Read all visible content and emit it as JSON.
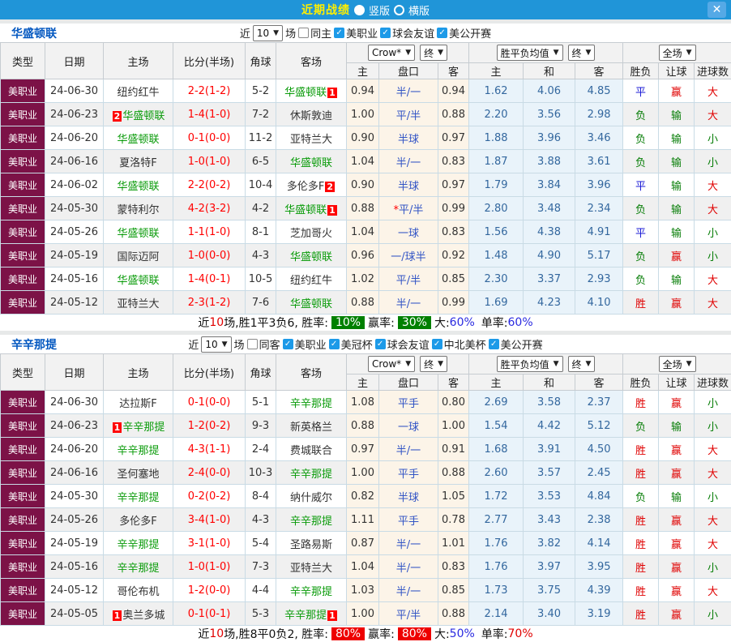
{
  "colors": {
    "accent_blue": "#2095d8",
    "title_yellow": "#ffef00",
    "type_cell_maroon": "#7c1247",
    "team_green": "#099b09",
    "score_red": "#ff0000",
    "win_red": "#e00000",
    "lose_green": "#067d06",
    "draw_blue": "#1b1bd6"
  },
  "topbar": {
    "title": "近期战绩",
    "vertical_label": "竖版",
    "horizontal_label": "横版",
    "close_label": "✕"
  },
  "controls": {
    "near_label": "近",
    "games_label": "场",
    "bookmaker": "Crow*",
    "final_label_asia": "终",
    "odds_average": "胜平负均值",
    "final_label_europe": "终",
    "scope": "全场"
  },
  "table": {
    "col_type": "类型",
    "col_date": "日期",
    "col_home": "主场",
    "col_score": "比分(半场)",
    "col_corner": "角球",
    "col_away": "客场",
    "col_ah_home": "主",
    "col_handicap": "盘口",
    "col_ah_away": "客",
    "col_eu_home": "主",
    "col_eu_draw": "和",
    "col_eu_away": "客",
    "col_result": "胜负",
    "col_handicap_result": "让球",
    "col_goals": "进球数"
  },
  "sections": [
    {
      "team": "华盛顿联",
      "games_count": "10",
      "same_label": "同主",
      "same_checked": false,
      "leagues": [
        {
          "label": "美职业",
          "checked": true
        },
        {
          "label": "球会友谊",
          "checked": true
        },
        {
          "label": "美公开赛",
          "checked": true
        }
      ],
      "rows": [
        {
          "type": "美职业",
          "date": "24-06-30",
          "home": "纽约红牛",
          "home_green": false,
          "home_badge": "",
          "home_badge_pos": "",
          "score": "2-2(1-2)",
          "corner": "5-2",
          "away": "华盛顿联",
          "away_green": true,
          "away_badge": "1",
          "away_badge_pos": "after",
          "ah_home": "0.94",
          "handicap": "半/一",
          "handicap_star": false,
          "ah_away": "0.94",
          "eu_home": "1.62",
          "eu_draw": "4.06",
          "eu_away": "4.85",
          "result": "平",
          "handicap_result": "赢",
          "goals": "大"
        },
        {
          "type": "美职业",
          "date": "24-06-23",
          "home": "华盛顿联",
          "home_green": true,
          "home_badge": "2",
          "home_badge_pos": "before",
          "score": "1-4(1-0)",
          "corner": "7-2",
          "away": "休斯敦迪",
          "away_green": false,
          "away_badge": "",
          "away_badge_pos": "",
          "ah_home": "1.00",
          "handicap": "平/半",
          "handicap_star": false,
          "ah_away": "0.88",
          "eu_home": "2.20",
          "eu_draw": "3.56",
          "eu_away": "2.98",
          "result": "负",
          "handicap_result": "输",
          "goals": "大"
        },
        {
          "type": "美职业",
          "date": "24-06-20",
          "home": "华盛顿联",
          "home_green": true,
          "home_badge": "",
          "home_badge_pos": "",
          "score": "0-1(0-0)",
          "corner": "11-2",
          "away": "亚特兰大",
          "away_green": false,
          "away_badge": "",
          "away_badge_pos": "",
          "ah_home": "0.90",
          "handicap": "半球",
          "handicap_star": false,
          "ah_away": "0.97",
          "eu_home": "1.88",
          "eu_draw": "3.96",
          "eu_away": "3.46",
          "result": "负",
          "handicap_result": "输",
          "goals": "小"
        },
        {
          "type": "美职业",
          "date": "24-06-16",
          "home": "夏洛特F",
          "home_green": false,
          "home_badge": "",
          "home_badge_pos": "",
          "score": "1-0(1-0)",
          "corner": "6-5",
          "away": "华盛顿联",
          "away_green": true,
          "away_badge": "",
          "away_badge_pos": "",
          "ah_home": "1.04",
          "handicap": "半/一",
          "handicap_star": false,
          "ah_away": "0.83",
          "eu_home": "1.87",
          "eu_draw": "3.88",
          "eu_away": "3.61",
          "result": "负",
          "handicap_result": "输",
          "goals": "小"
        },
        {
          "type": "美职业",
          "date": "24-06-02",
          "home": "华盛顿联",
          "home_green": true,
          "home_badge": "",
          "home_badge_pos": "",
          "score": "2-2(0-2)",
          "corner": "10-4",
          "away": "多伦多F",
          "away_green": false,
          "away_badge": "2",
          "away_badge_pos": "after",
          "ah_home": "0.90",
          "handicap": "半球",
          "handicap_star": false,
          "ah_away": "0.97",
          "eu_home": "1.79",
          "eu_draw": "3.84",
          "eu_away": "3.96",
          "result": "平",
          "handicap_result": "输",
          "goals": "大"
        },
        {
          "type": "美职业",
          "date": "24-05-30",
          "home": "蒙特利尔",
          "home_green": false,
          "home_badge": "",
          "home_badge_pos": "",
          "score": "4-2(3-2)",
          "corner": "4-2",
          "away": "华盛顿联",
          "away_green": true,
          "away_badge": "1",
          "away_badge_pos": "after",
          "ah_home": "0.88",
          "handicap": "平/半",
          "handicap_star": true,
          "ah_away": "0.99",
          "eu_home": "2.80",
          "eu_draw": "3.48",
          "eu_away": "2.34",
          "result": "负",
          "handicap_result": "输",
          "goals": "大"
        },
        {
          "type": "美职业",
          "date": "24-05-26",
          "home": "华盛顿联",
          "home_green": true,
          "home_badge": "",
          "home_badge_pos": "",
          "score": "1-1(1-0)",
          "corner": "8-1",
          "away": "芝加哥火",
          "away_green": false,
          "away_badge": "",
          "away_badge_pos": "",
          "ah_home": "1.04",
          "handicap": "一球",
          "handicap_star": false,
          "ah_away": "0.83",
          "eu_home": "1.56",
          "eu_draw": "4.38",
          "eu_away": "4.91",
          "result": "平",
          "handicap_result": "输",
          "goals": "小"
        },
        {
          "type": "美职业",
          "date": "24-05-19",
          "home": "国际迈阿",
          "home_green": false,
          "home_badge": "",
          "home_badge_pos": "",
          "score": "1-0(0-0)",
          "corner": "4-3",
          "away": "华盛顿联",
          "away_green": true,
          "away_badge": "",
          "away_badge_pos": "",
          "ah_home": "0.96",
          "handicap": "一/球半",
          "handicap_star": false,
          "ah_away": "0.92",
          "eu_home": "1.48",
          "eu_draw": "4.90",
          "eu_away": "5.17",
          "result": "负",
          "handicap_result": "赢",
          "goals": "小"
        },
        {
          "type": "美职业",
          "date": "24-05-16",
          "home": "华盛顿联",
          "home_green": true,
          "home_badge": "",
          "home_badge_pos": "",
          "score": "1-4(0-1)",
          "corner": "10-5",
          "away": "纽约红牛",
          "away_green": false,
          "away_badge": "",
          "away_badge_pos": "",
          "ah_home": "1.02",
          "handicap": "平/半",
          "handicap_star": false,
          "ah_away": "0.85",
          "eu_home": "2.30",
          "eu_draw": "3.37",
          "eu_away": "2.93",
          "result": "负",
          "handicap_result": "输",
          "goals": "大"
        },
        {
          "type": "美职业",
          "date": "24-05-12",
          "home": "亚特兰大",
          "home_green": false,
          "home_badge": "",
          "home_badge_pos": "",
          "score": "2-3(1-2)",
          "corner": "7-6",
          "away": "华盛顿联",
          "away_green": true,
          "away_badge": "",
          "away_badge_pos": "",
          "ah_home": "0.88",
          "handicap": "半/一",
          "handicap_star": false,
          "ah_away": "0.99",
          "eu_home": "1.69",
          "eu_draw": "4.23",
          "eu_away": "4.10",
          "result": "胜",
          "handicap_result": "赢",
          "goals": "大"
        }
      ],
      "summary": {
        "lead_plain": "近",
        "lead_games": "10",
        "lead_rest": "场,胜1平3负6, 胜率:",
        "rate1": "10%",
        "rate1_bg": "#008000",
        "mid": "赢率:",
        "rate2": "30%",
        "rate2_bg": "#008000",
        "big_label": "大:",
        "big_value": "60%",
        "big_color": "#2a2ae0",
        "single_label": "单率:",
        "single_value": "60%",
        "single_color": "#2a2ae0"
      }
    },
    {
      "team": "辛辛那提",
      "games_count": "10",
      "same_label": "同客",
      "same_checked": false,
      "leagues": [
        {
          "label": "美职业",
          "checked": true
        },
        {
          "label": "美冠杯",
          "checked": true
        },
        {
          "label": "球会友谊",
          "checked": true
        },
        {
          "label": "中北美杯",
          "checked": true
        },
        {
          "label": "美公开赛",
          "checked": true
        }
      ],
      "rows": [
        {
          "type": "美职业",
          "date": "24-06-30",
          "home": "达拉斯F",
          "home_green": false,
          "home_badge": "",
          "home_badge_pos": "",
          "score": "0-1(0-0)",
          "corner": "5-1",
          "away": "辛辛那提",
          "away_green": true,
          "away_badge": "",
          "away_badge_pos": "",
          "ah_home": "1.08",
          "handicap": "平手",
          "handicap_star": false,
          "ah_away": "0.80",
          "eu_home": "2.69",
          "eu_draw": "3.58",
          "eu_away": "2.37",
          "result": "胜",
          "handicap_result": "赢",
          "goals": "小"
        },
        {
          "type": "美职业",
          "date": "24-06-23",
          "home": "辛辛那提",
          "home_green": true,
          "home_badge": "1",
          "home_badge_pos": "before",
          "score": "1-2(0-2)",
          "corner": "9-3",
          "away": "新英格兰",
          "away_green": false,
          "away_badge": "",
          "away_badge_pos": "",
          "ah_home": "0.88",
          "handicap": "一球",
          "handicap_star": false,
          "ah_away": "1.00",
          "eu_home": "1.54",
          "eu_draw": "4.42",
          "eu_away": "5.12",
          "result": "负",
          "handicap_result": "输",
          "goals": "小"
        },
        {
          "type": "美职业",
          "date": "24-06-20",
          "home": "辛辛那提",
          "home_green": true,
          "home_badge": "",
          "home_badge_pos": "",
          "score": "4-3(1-1)",
          "corner": "2-4",
          "away": "费城联合",
          "away_green": false,
          "away_badge": "",
          "away_badge_pos": "",
          "ah_home": "0.97",
          "handicap": "半/一",
          "handicap_star": false,
          "ah_away": "0.91",
          "eu_home": "1.68",
          "eu_draw": "3.91",
          "eu_away": "4.50",
          "result": "胜",
          "handicap_result": "赢",
          "goals": "大"
        },
        {
          "type": "美职业",
          "date": "24-06-16",
          "home": "圣何塞地",
          "home_green": false,
          "home_badge": "",
          "home_badge_pos": "",
          "score": "2-4(0-0)",
          "corner": "10-3",
          "away": "辛辛那提",
          "away_green": true,
          "away_badge": "",
          "away_badge_pos": "",
          "ah_home": "1.00",
          "handicap": "平手",
          "handicap_star": false,
          "ah_away": "0.88",
          "eu_home": "2.60",
          "eu_draw": "3.57",
          "eu_away": "2.45",
          "result": "胜",
          "handicap_result": "赢",
          "goals": "大"
        },
        {
          "type": "美职业",
          "date": "24-05-30",
          "home": "辛辛那提",
          "home_green": true,
          "home_badge": "",
          "home_badge_pos": "",
          "score": "0-2(0-2)",
          "corner": "8-4",
          "away": "纳什威尔",
          "away_green": false,
          "away_badge": "",
          "away_badge_pos": "",
          "ah_home": "0.82",
          "handicap": "半球",
          "handicap_star": false,
          "ah_away": "1.05",
          "eu_home": "1.72",
          "eu_draw": "3.53",
          "eu_away": "4.84",
          "result": "负",
          "handicap_result": "输",
          "goals": "小"
        },
        {
          "type": "美职业",
          "date": "24-05-26",
          "home": "多伦多F",
          "home_green": false,
          "home_badge": "",
          "home_badge_pos": "",
          "score": "3-4(1-0)",
          "corner": "4-3",
          "away": "辛辛那提",
          "away_green": true,
          "away_badge": "",
          "away_badge_pos": "",
          "ah_home": "1.11",
          "handicap": "平手",
          "handicap_star": false,
          "ah_away": "0.78",
          "eu_home": "2.77",
          "eu_draw": "3.43",
          "eu_away": "2.38",
          "result": "胜",
          "handicap_result": "赢",
          "goals": "大"
        },
        {
          "type": "美职业",
          "date": "24-05-19",
          "home": "辛辛那提",
          "home_green": true,
          "home_badge": "",
          "home_badge_pos": "",
          "score": "3-1(1-0)",
          "corner": "5-4",
          "away": "圣路易斯",
          "away_green": false,
          "away_badge": "",
          "away_badge_pos": "",
          "ah_home": "0.87",
          "handicap": "半/一",
          "handicap_star": false,
          "ah_away": "1.01",
          "eu_home": "1.76",
          "eu_draw": "3.82",
          "eu_away": "4.14",
          "result": "胜",
          "handicap_result": "赢",
          "goals": "大"
        },
        {
          "type": "美职业",
          "date": "24-05-16",
          "home": "辛辛那提",
          "home_green": true,
          "home_badge": "",
          "home_badge_pos": "",
          "score": "1-0(1-0)",
          "corner": "7-3",
          "away": "亚特兰大",
          "away_green": false,
          "away_badge": "",
          "away_badge_pos": "",
          "ah_home": "1.04",
          "handicap": "半/一",
          "handicap_star": false,
          "ah_away": "0.83",
          "eu_home": "1.76",
          "eu_draw": "3.97",
          "eu_away": "3.95",
          "result": "胜",
          "handicap_result": "赢",
          "goals": "小"
        },
        {
          "type": "美职业",
          "date": "24-05-12",
          "home": "哥伦布机",
          "home_green": false,
          "home_badge": "",
          "home_badge_pos": "",
          "score": "1-2(0-0)",
          "corner": "4-4",
          "away": "辛辛那提",
          "away_green": true,
          "away_badge": "",
          "away_badge_pos": "",
          "ah_home": "1.03",
          "handicap": "半/一",
          "handicap_star": false,
          "ah_away": "0.85",
          "eu_home": "1.73",
          "eu_draw": "3.75",
          "eu_away": "4.39",
          "result": "胜",
          "handicap_result": "赢",
          "goals": "大"
        },
        {
          "type": "美职业",
          "date": "24-05-05",
          "home": "奥兰多城",
          "home_green": false,
          "home_badge": "1",
          "home_badge_pos": "before",
          "score": "0-1(0-1)",
          "corner": "5-3",
          "away": "辛辛那提",
          "away_green": true,
          "away_badge": "1",
          "away_badge_pos": "after",
          "ah_home": "1.00",
          "handicap": "平/半",
          "handicap_star": false,
          "ah_away": "0.88",
          "eu_home": "2.14",
          "eu_draw": "3.40",
          "eu_away": "3.19",
          "result": "胜",
          "handicap_result": "赢",
          "goals": "小"
        }
      ],
      "summary": {
        "lead_plain": "近",
        "lead_games": "10",
        "lead_rest": "场,胜8平0负2, 胜率:",
        "rate1": "80%",
        "rate1_bg": "#ee0000",
        "mid": "赢率:",
        "rate2": "80%",
        "rate2_bg": "#ee0000",
        "big_label": "大:",
        "big_value": "50%",
        "big_color": "#2a2ae0",
        "single_label": "单率:",
        "single_value": "70%",
        "single_color": "#e00000"
      }
    }
  ]
}
